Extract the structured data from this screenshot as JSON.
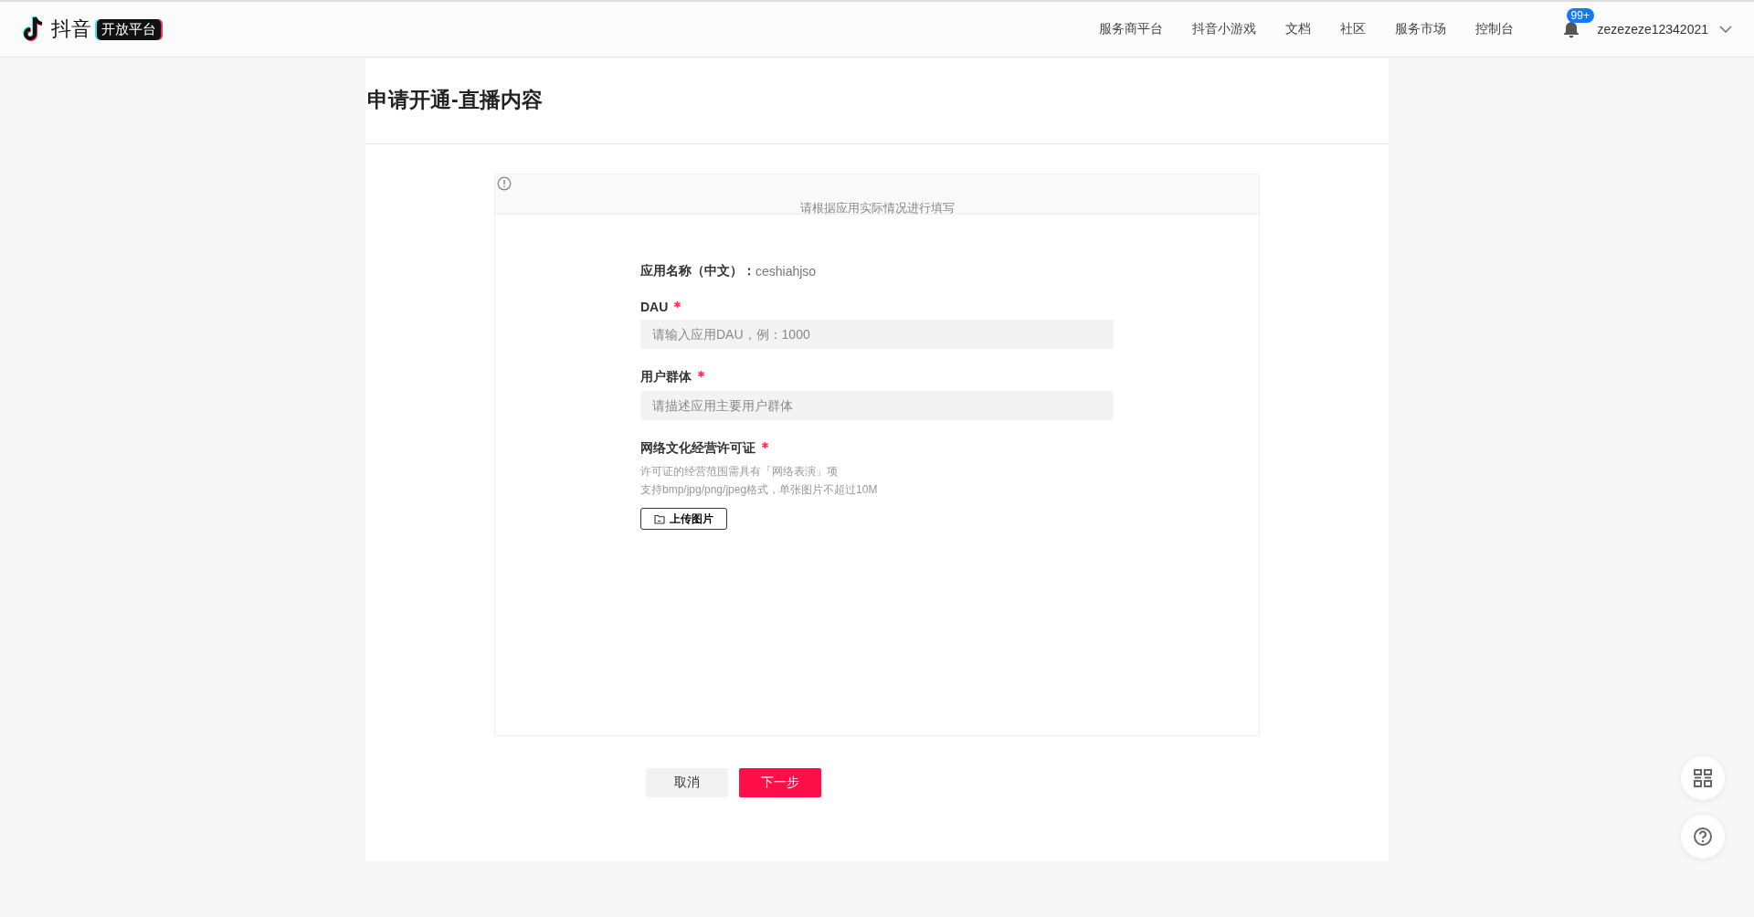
{
  "header": {
    "logo_text": "抖音",
    "logo_badge": "开放平台",
    "nav": [
      "服务商平台",
      "抖音小游戏",
      "文档",
      "社区",
      "服务市场",
      "控制台"
    ],
    "notification_count": "99+",
    "username": "zezezeze12342021"
  },
  "page": {
    "title": "申请开通-直播内容"
  },
  "notice": {
    "text": "请根据应用实际情况进行填写"
  },
  "app_name": {
    "label": "应用名称（中文）：",
    "value": "ceshiahjso"
  },
  "fields": [
    {
      "kind": "input",
      "label": "DAU",
      "required": true,
      "placeholder": "请输入应用DAU，例：1000"
    },
    {
      "kind": "input",
      "label": "用户群体",
      "required": true,
      "placeholder": "请描述应用主要用户群体"
    },
    {
      "kind": "upload",
      "label": "网络文化经营许可证",
      "required": true,
      "hints": [
        "许可证的经营范围需具有「网络表演」项",
        "支持bmp/jpg/png/jpeg格式，单张图片不超过10M"
      ],
      "button": "上传图片"
    }
  ],
  "buttons": {
    "cancel": "取消",
    "next": "下一步"
  }
}
